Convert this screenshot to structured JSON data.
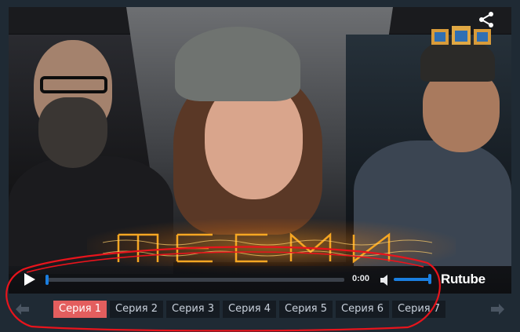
{
  "player": {
    "brand": "Rutube",
    "time": "0:00",
    "progress": 0.0,
    "volume": 1.0
  },
  "episodes": [
    {
      "label": "Серия 1",
      "active": true
    },
    {
      "label": "Серия 2",
      "active": false
    },
    {
      "label": "Серия 3",
      "active": false
    },
    {
      "label": "Серия 4",
      "active": false
    },
    {
      "label": "Серия 5",
      "active": false
    },
    {
      "label": "Серия 6",
      "active": false
    },
    {
      "label": "Серия 7",
      "active": false
    }
  ],
  "icons": {
    "play": "play-icon",
    "volume": "volume-icon",
    "share": "share-icon",
    "prev": "arrow-left-icon",
    "next": "arrow-right-icon"
  },
  "colors": {
    "accent": "#1a7ee0",
    "active_episode": "#e35e5e",
    "annotation": "#e8141c"
  }
}
